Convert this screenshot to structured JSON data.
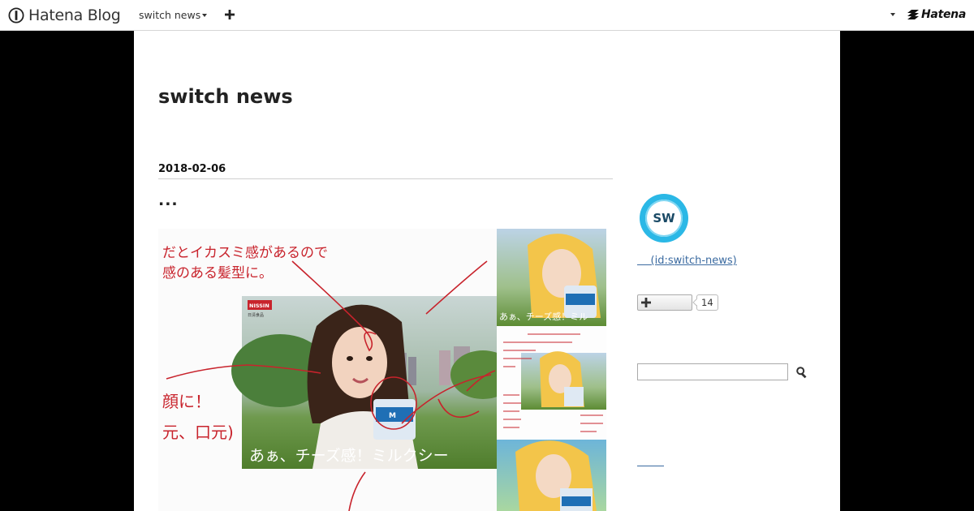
{
  "header": {
    "brand_name": "Hatena Blog",
    "blog_menu_label": "switch news",
    "hatena_logo_text": "Hatena"
  },
  "blog": {
    "title": "switch news"
  },
  "entry": {
    "date": "2018-02-06",
    "title": "..."
  },
  "sidebar": {
    "avatar_initials": "SW",
    "profile_link": "    (id:switch-news)",
    "star_count": "14",
    "search_placeholder": ""
  },
  "image": {
    "handwriting_top": "だとイカスミ感があるので",
    "handwriting_top2": "感のある髪型に。",
    "handwriting_left": "顔に！",
    "handwriting_left2": "元、口元)",
    "ad_copy": "あぁ、チーズ感！ミルクシー",
    "ad_copy_small": "あぁ、チーズ感！ミル",
    "brand_mark": "NISSIN",
    "small_mark": "日清食品"
  },
  "colors": {
    "accent_blue": "#2bb8e6",
    "link_blue": "#3a6aa0",
    "ink_red": "#c8232c"
  }
}
